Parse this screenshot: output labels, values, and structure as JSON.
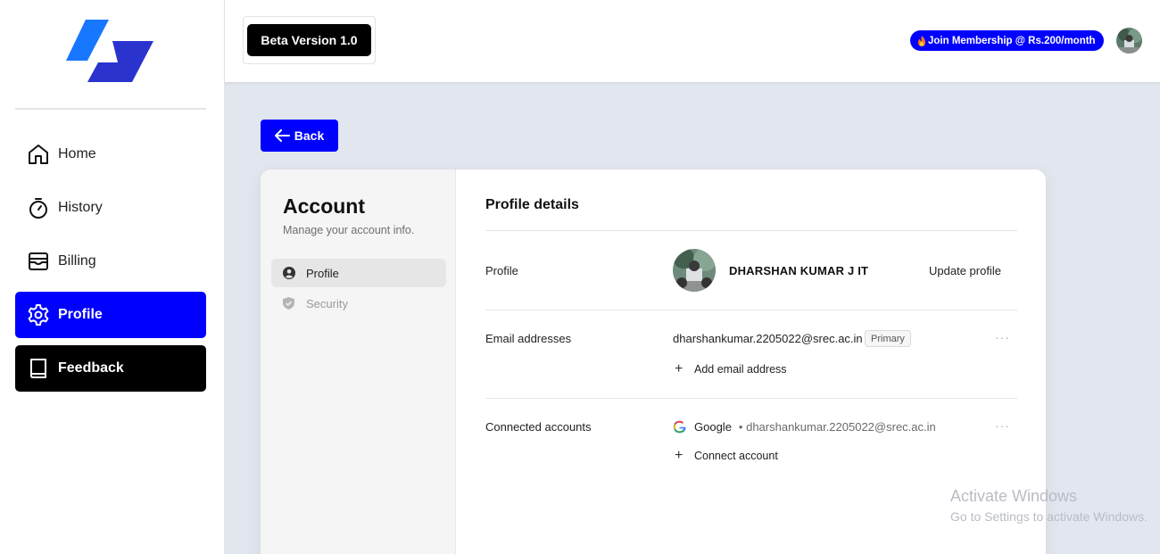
{
  "header": {
    "beta_label": "Beta Version 1.0",
    "membership_label": "Join Membership @ Rs.200/month",
    "membership_icon": "fire-icon"
  },
  "sidebar": {
    "items": [
      {
        "label": "Home",
        "icon": "home-icon"
      },
      {
        "label": "History",
        "icon": "stopwatch-icon"
      },
      {
        "label": "Billing",
        "icon": "wallet-icon"
      },
      {
        "label": "Profile",
        "icon": "gear-icon",
        "active": true
      },
      {
        "label": "Feedback",
        "icon": "book-icon"
      }
    ]
  },
  "back_label": "Back",
  "account": {
    "title": "Account",
    "subtitle": "Manage your account info.",
    "tabs": [
      {
        "label": "Profile",
        "icon": "user-circle-icon",
        "active": true
      },
      {
        "label": "Security",
        "icon": "shield-icon",
        "active": false
      }
    ]
  },
  "profile_details": {
    "title": "Profile details",
    "profile_label": "Profile",
    "name": "DHARSHAN KUMAR J IT",
    "update_label": "Update profile",
    "email_label": "Email addresses",
    "email": "dharshankumar.2205022@srec.ac.in",
    "primary_badge": "Primary",
    "add_email_label": "Add email address",
    "connected_label": "Connected accounts",
    "provider": "Google",
    "provider_email": "• dharshankumar.2205022@srec.ac.in",
    "connect_label": "Connect account",
    "more_label": "···"
  },
  "watermark": {
    "line1": "Activate Windows",
    "line2": "Go to Settings to activate Windows."
  },
  "colors": {
    "accent": "#0000ff",
    "dark": "#000000",
    "page_bg": "#e2e6ee"
  }
}
